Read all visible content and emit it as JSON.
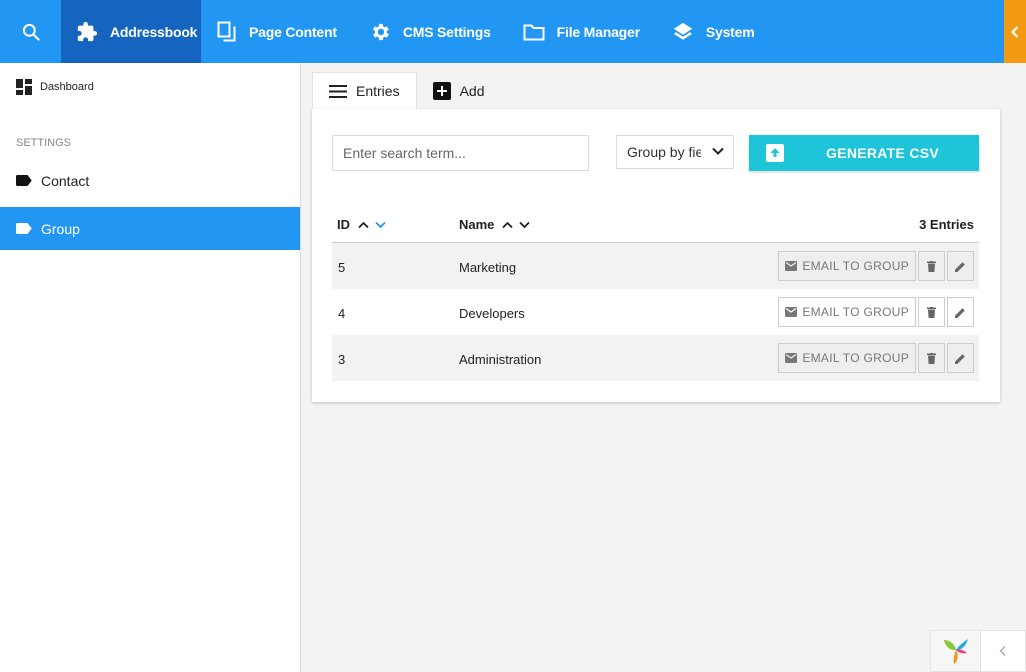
{
  "topbar": {
    "items": [
      {
        "label": "Addressbook",
        "icon": "puzzle-icon",
        "active": true
      },
      {
        "label": "Page Content",
        "icon": "copy-icon"
      },
      {
        "label": "CMS Settings",
        "icon": "gear-icon"
      },
      {
        "label": "File Manager",
        "icon": "folder-icon"
      },
      {
        "label": "System",
        "icon": "layers-icon"
      }
    ],
    "colors": {
      "primary": "#2196f3",
      "active": "#1565c0",
      "accent": "#f39a12"
    }
  },
  "sidebar": {
    "dashboard": "Dashboard",
    "heading": "SETTINGS",
    "items": [
      {
        "label": "Contact",
        "icon": "label-icon"
      },
      {
        "label": "Group",
        "icon": "label-icon",
        "active": true
      }
    ]
  },
  "tabs": [
    {
      "label": "Entries",
      "icon": "menu-icon",
      "active": true
    },
    {
      "label": "Add",
      "icon": "add-box-icon"
    }
  ],
  "toolbar": {
    "search_placeholder": "Enter search term...",
    "group_by": "Group by field",
    "generate_label": "GENERATE CSV",
    "generate_color": "#1ec5d8"
  },
  "table": {
    "columns": {
      "id": "ID",
      "name": "Name"
    },
    "count": "3 Entries",
    "email_label": "EMAIL TO GROUP",
    "rows": [
      {
        "id": "5",
        "name": "Marketing"
      },
      {
        "id": "4",
        "name": "Developers"
      },
      {
        "id": "3",
        "name": "Administration"
      }
    ]
  }
}
